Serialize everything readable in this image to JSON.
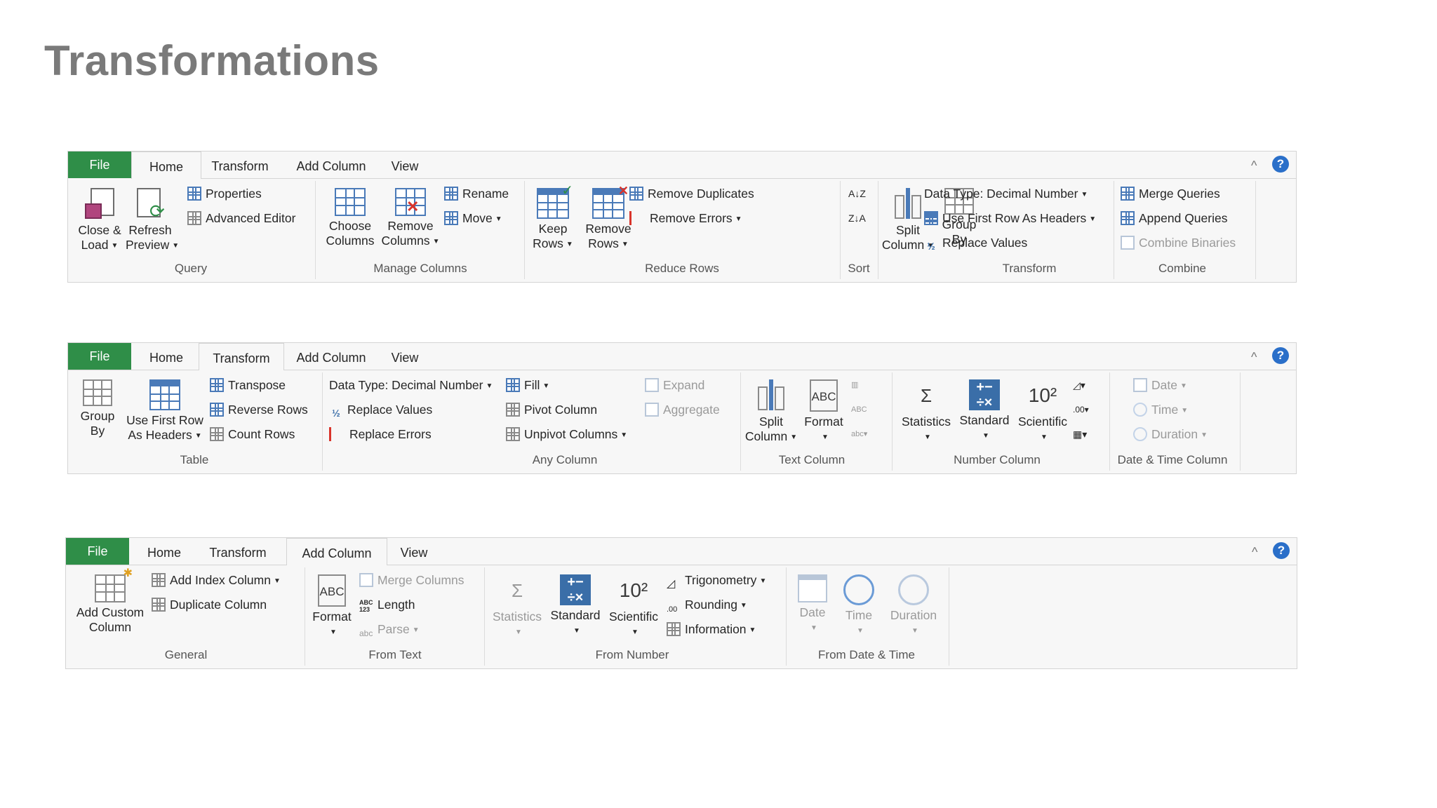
{
  "page_title": "Transformations",
  "ribbons": [
    {
      "tabs": [
        "File",
        "Home",
        "Transform",
        "Add Column",
        "View"
      ],
      "active_tab": "Home",
      "collapse_glyph": "^",
      "help_glyph": "?",
      "groups": {
        "query": {
          "label": "Query",
          "close_load": [
            "Close &",
            "Load"
          ],
          "refresh_preview": [
            "Refresh",
            "Preview"
          ],
          "properties": "Properties",
          "advanced_editor": "Advanced Editor"
        },
        "manage_columns": {
          "label": "Manage Columns",
          "choose_columns": [
            "Choose",
            "Columns"
          ],
          "remove_columns": [
            "Remove",
            "Columns"
          ],
          "rename": "Rename",
          "move": "Move"
        },
        "reduce_rows": {
          "label": "Reduce Rows",
          "keep_rows": [
            "Keep",
            "Rows"
          ],
          "remove_rows": [
            "Remove",
            "Rows"
          ],
          "remove_duplicates": "Remove Duplicates",
          "remove_errors": "Remove Errors"
        },
        "sort": {
          "label": "Sort",
          "asc": "A↓Z",
          "desc": "Z↓A"
        },
        "transform": {
          "label": "Transform",
          "split_column": [
            "Split",
            "Column"
          ],
          "group_by": [
            "Group",
            "By"
          ],
          "data_type": "Data Type: Decimal Number",
          "use_first_row": "Use First Row As Headers",
          "replace_values": "Replace Values"
        },
        "combine": {
          "label": "Combine",
          "merge_queries": "Merge Queries",
          "append_queries": "Append Queries",
          "combine_binaries": "Combine Binaries"
        }
      }
    },
    {
      "tabs": [
        "File",
        "Home",
        "Transform",
        "Add Column",
        "View"
      ],
      "active_tab": "Transform",
      "collapse_glyph": "^",
      "help_glyph": "?",
      "groups": {
        "table": {
          "label": "Table",
          "group_by": [
            "Group",
            "By"
          ],
          "use_first_row": [
            "Use First Row",
            "As Headers"
          ],
          "transpose": "Transpose",
          "reverse_rows": "Reverse Rows",
          "count_rows": "Count Rows"
        },
        "any_column": {
          "label": "Any Column",
          "data_type": "Data Type: Decimal Number",
          "replace_values": "Replace Values",
          "replace_errors": "Replace Errors",
          "fill": "Fill",
          "pivot_column": "Pivot Column",
          "unpivot_columns": "Unpivot Columns",
          "expand": "Expand",
          "aggregate": "Aggregate"
        },
        "text_column": {
          "label": "Text Column",
          "split_column": [
            "Split",
            "Column"
          ],
          "format": "Format"
        },
        "number_column": {
          "label": "Number Column",
          "statistics": "Statistics",
          "standard": "Standard",
          "scientific": "Scientific"
        },
        "date_time_column": {
          "label": "Date & Time Column",
          "date": "Date",
          "time": "Time",
          "duration": "Duration"
        }
      }
    },
    {
      "tabs": [
        "File",
        "Home",
        "Transform",
        "Add Column",
        "View"
      ],
      "active_tab": "Add Column",
      "collapse_glyph": "^",
      "help_glyph": "?",
      "groups": {
        "general": {
          "label": "General",
          "add_custom_column": [
            "Add Custom",
            "Column"
          ],
          "add_index_column": "Add Index Column",
          "duplicate_column": "Duplicate Column"
        },
        "from_text": {
          "label": "From Text",
          "format": "Format",
          "merge_columns": "Merge Columns",
          "length": "Length",
          "parse": "Parse"
        },
        "from_number": {
          "label": "From Number",
          "statistics": "Statistics",
          "standard": "Standard",
          "scientific": "Scientific",
          "trigonometry": "Trigonometry",
          "rounding": "Rounding",
          "information": "Information"
        },
        "from_date_time": {
          "label": "From Date & Time",
          "date": "Date",
          "time": "Time",
          "duration": "Duration"
        }
      }
    }
  ],
  "colors": {
    "file_tab": "#2f8e48",
    "accent_blue": "#2a6fc9",
    "title_gray": "#7a7a7a"
  }
}
